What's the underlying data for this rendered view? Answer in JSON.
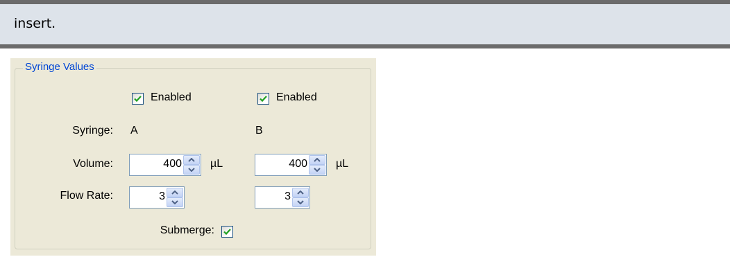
{
  "header": {
    "text": "insert."
  },
  "group": {
    "title": "Syringe Values",
    "enabled_a_label": "Enabled",
    "enabled_b_label": "Enabled",
    "enabled_a_checked": true,
    "enabled_b_checked": true,
    "syringe_label": "Syringe:",
    "syringe_a": "A",
    "syringe_b": "B",
    "volume_label": "Volume:",
    "volume_a": "400",
    "volume_b": "400",
    "volume_unit_a": "µL",
    "volume_unit_b": "µL",
    "flow_rate_label": "Flow Rate:",
    "flow_rate_a": "3",
    "flow_rate_b": "3",
    "submerge_label": "Submerge:",
    "submerge_checked": true
  },
  "colors": {
    "header_bg": "#dde3ea",
    "header_border": "#6b6b6b",
    "dialog_bg": "#ece9d8",
    "group_title": "#0046d5",
    "check_mark": "#21a121"
  },
  "icons": {
    "checkmark": "check-icon",
    "spin_up": "chevron-up-icon",
    "spin_down": "chevron-down-icon"
  }
}
